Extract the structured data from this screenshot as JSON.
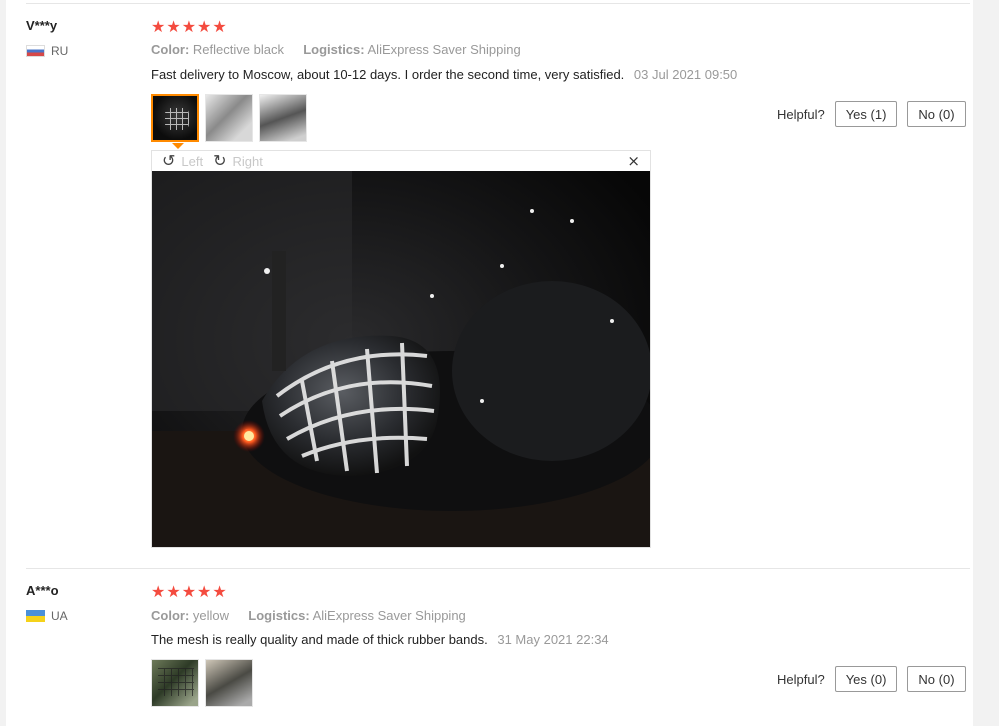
{
  "reviews": [
    {
      "user": "V***y",
      "country": "RU",
      "rating": 5,
      "color_label": "Color:",
      "color_value": "Reflective black",
      "logistics_label": "Logistics:",
      "logistics_value": "AliExpress Saver Shipping",
      "text": "Fast delivery to Moscow, about 10-12 days. I order the second time, very satisfied.",
      "date": "03 Jul 2021 09:50",
      "helpful_label": "Helpful?",
      "yes_label": "Yes (1)",
      "no_label": "No (0)",
      "photo_count": 3
    },
    {
      "user": "A***o",
      "country": "UA",
      "rating": 5,
      "color_label": "Color:",
      "color_value": "yellow",
      "logistics_label": "Logistics:",
      "logistics_value": "AliExpress Saver Shipping",
      "text": "The mesh is really quality and made of thick rubber bands.",
      "date": "31 May 2021 22:34",
      "helpful_label": "Helpful?",
      "yes_label": "Yes (0)",
      "no_label": "No (0)",
      "photo_count": 2
    }
  ],
  "viewer": {
    "rotate_left_label": "Left",
    "rotate_right_label": "Right",
    "close_symbol": "×",
    "rotate_left_icon": "↺",
    "rotate_right_icon": "↻"
  },
  "icons": {
    "star": "★"
  },
  "colors": {
    "star": "#f44b3f",
    "active_thumb": "#ff8a00"
  }
}
